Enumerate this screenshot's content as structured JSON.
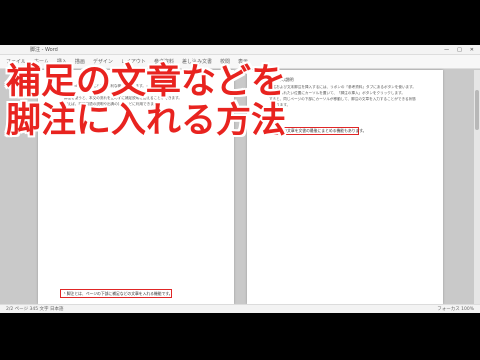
{
  "window": {
    "title": "脚注 - Word",
    "controls": [
      "—",
      "□",
      "✕"
    ]
  },
  "ribbon": {
    "items": [
      "ファイル",
      "ホーム",
      "挿入",
      "描画",
      "デザイン",
      "レイアウト",
      "参考資料",
      "差し込み文書",
      "校閲",
      "表示"
    ]
  },
  "overlay": {
    "line1": "補足の文章などを",
    "line2": "脚注に入れる方法"
  },
  "left_page": {
    "lines": [
      "「Word には、脚注という便利な機能があります。」",
      "",
      "脚注を使うと、本文の流れを止めずに補足説明を加えることができます。",
      "例えば、専門用語の説明や出典の記載などに利用できます。"
    ],
    "footnote_text": "¹ 脚注とは、ページの下部に補足などの文章を入れる機能です。"
  },
  "right_page": {
    "heading": "●脚注の説明",
    "lines": [
      "脚注および文末脚注を挿入するには、リボンの「参考資料」タブにあるボタンを使います。",
      "脚注を入れたい位置にカーソルを置いて、「脚注の挿入」ボタンをクリックします。",
      "すると、同じページの下部にカーソルが移動して、脚注の文章を入力することができる状態",
      "になります。"
    ],
    "footnote_text": "¹ 脚注の文章を文書の最後にまとめる機能もあります。"
  },
  "status": {
    "left": "2/2 ページ   345 文字   日本語",
    "right": "フォーカス   100%"
  }
}
